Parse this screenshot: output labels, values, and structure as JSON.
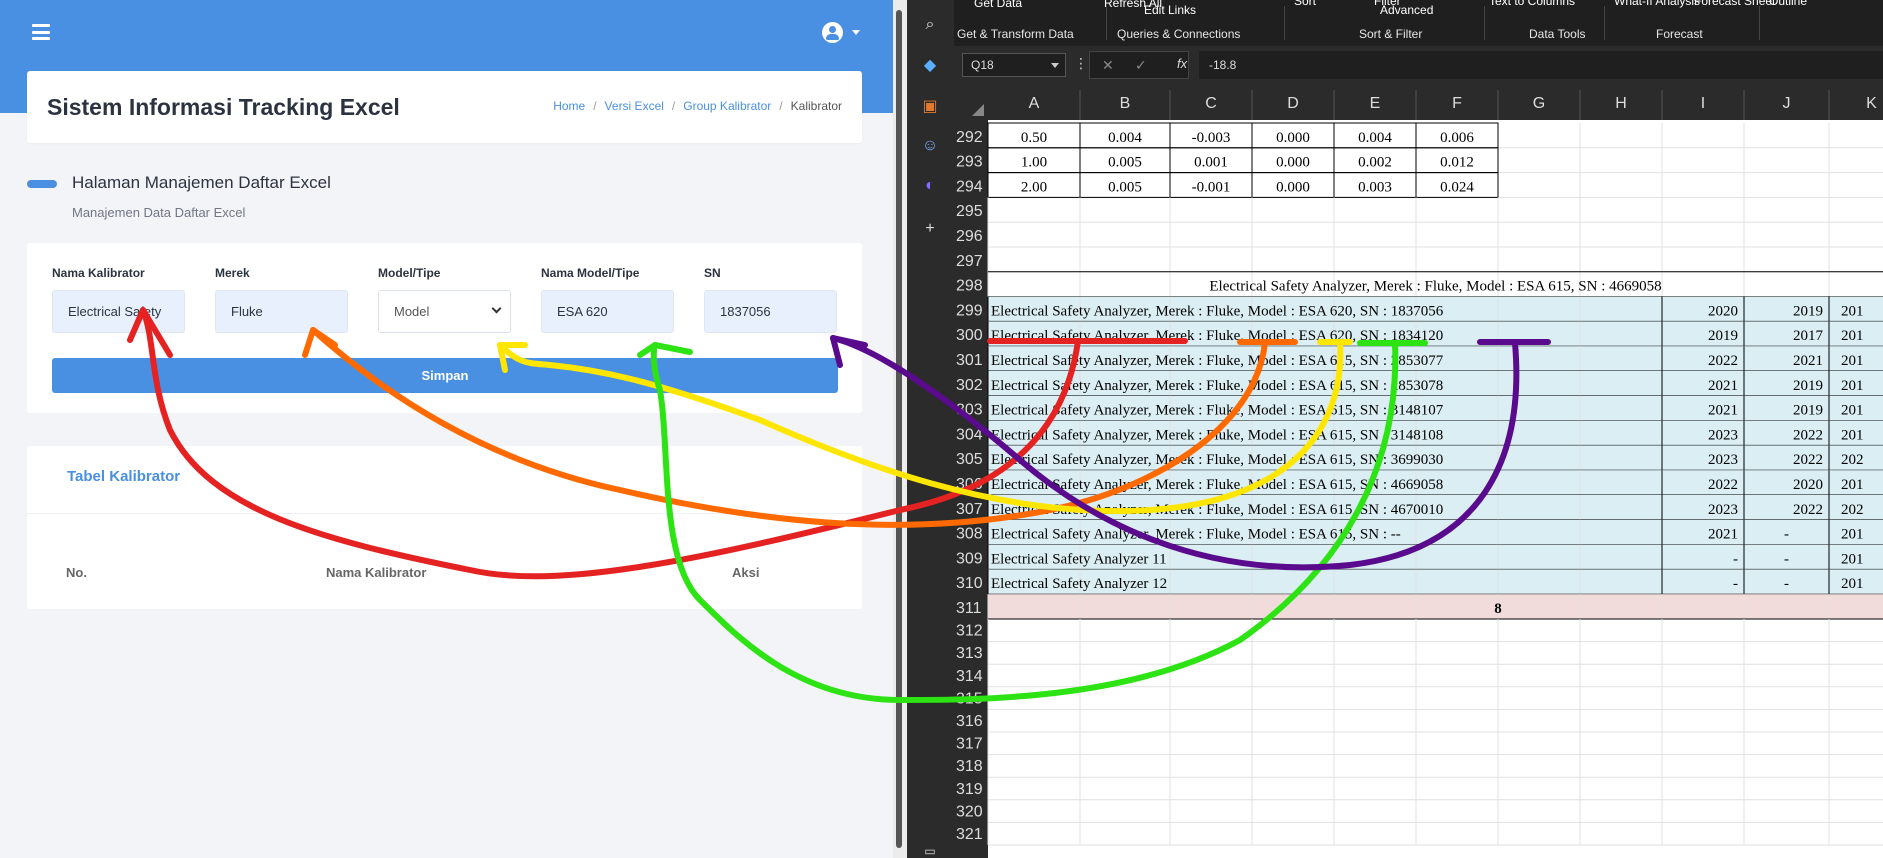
{
  "web": {
    "app_title": "Sistem Informasi Tracking Excel",
    "breadcrumbs": [
      "Home",
      "Versi Excel",
      "Group Kalibrator",
      "Kalibrator"
    ],
    "section_title": "Halaman Manajemen Daftar Excel",
    "section_subtitle": "Manajemen Data Daftar Excel",
    "form": {
      "labels": [
        "Nama Kalibrator",
        "Merek",
        "Model/Tipe",
        "Nama Model/Tipe",
        "SN"
      ],
      "nama_kalibrator": "Electrical Safety",
      "merek": "Fluke",
      "model_select": "Model",
      "nama_model": "ESA 620",
      "sn": "1837056",
      "save_label": "Simpan"
    },
    "table": {
      "title": "Tabel Kalibrator",
      "headers": [
        "No.",
        "Nama Kalibrator",
        "Aksi"
      ]
    },
    "colors": {
      "primary": "#4a90e2"
    }
  },
  "excel": {
    "ribbon": {
      "items": [
        "Get Data",
        "Refresh All",
        "Edit Links",
        "Sort",
        "Filter",
        "Advanced",
        "Text to Columns",
        "What-If Analysis",
        "Forecast Sheet",
        "Outline"
      ],
      "groups": [
        "Get & Transform Data",
        "Queries & Connections",
        "Sort & Filter",
        "Data Tools",
        "Forecast"
      ]
    },
    "name_box": "Q18",
    "fx": "fx",
    "formula": "-18.8",
    "columns": [
      "A",
      "B",
      "C",
      "D",
      "E",
      "F",
      "G",
      "H",
      "I",
      "J",
      "K"
    ],
    "top_rows": [
      {
        "row": "292",
        "cells": [
          "0.50",
          "0.004",
          "-0.003",
          "0.000",
          "0.004",
          "0.006"
        ]
      },
      {
        "row": "293",
        "cells": [
          "1.00",
          "0.005",
          "0.001",
          "0.000",
          "0.002",
          "0.012"
        ]
      },
      {
        "row": "294",
        "cells": [
          "2.00",
          "0.005",
          "-0.001",
          "0.000",
          "0.003",
          "0.024"
        ]
      }
    ],
    "empty_rows": [
      "295",
      "296",
      "297"
    ],
    "header_row": {
      "row": "298",
      "text": "Electrical Safety Analyzer, Merek : Fluke, Model : ESA 615, SN : 4669058"
    },
    "list_rows": [
      {
        "row": "299",
        "text": "Electrical Safety Analyzer, Merek : Fluke, Model : ESA 620, SN : 1837056",
        "i": "2020",
        "j": "2019",
        "k": "201"
      },
      {
        "row": "300",
        "text": "Electrical Safety Analyzer, Merek : Fluke, Model : ESA 620, SN : 1834120",
        "i": "2019",
        "j": "2017",
        "k": "201"
      },
      {
        "row": "301",
        "text": "Electrical Safety Analyzer, Merek : Fluke, Model : ESA 615, SN : 2853077",
        "i": "2022",
        "j": "2021",
        "k": "201"
      },
      {
        "row": "302",
        "text": "Electrical Safety Analyzer, Merek : Fluke, Model : ESA 615, SN : 2853078",
        "i": "2021",
        "j": "2019",
        "k": "201"
      },
      {
        "row": "303",
        "text": "Electrical Safety Analyzer, Merek : Fluke, Model : ESA 615, SN : 3148107",
        "i": "2021",
        "j": "2019",
        "k": "201"
      },
      {
        "row": "304",
        "text": "Electrical Safety Analyzer, Merek : Fluke, Model : ESA 615, SN : 3148108",
        "i": "2023",
        "j": "2022",
        "k": "201"
      },
      {
        "row": "305",
        "text": "Electrical Safety Analyzer, Merek : Fluke, Model : ESA 615, SN : 3699030",
        "i": "2023",
        "j": "2022",
        "k": "202"
      },
      {
        "row": "306",
        "text": "Electrical Safety Analyzer, Merek : Fluke, Model : ESA 615, SN : 4669058",
        "i": "2022",
        "j": "2020",
        "k": "201"
      },
      {
        "row": "307",
        "text": "Electrical Safety Analyzer, Merek : Fluke, Model : ESA 615, SN : 4670010",
        "i": "2023",
        "j": "2022",
        "k": "202"
      },
      {
        "row": "308",
        "text": "Electrical Safety Analyzer, Merek : Fluke, Model : ESA 615, SN : --",
        "i": "2021",
        "j": "-",
        "k": "201"
      },
      {
        "row": "309",
        "text": "Electrical Safety Analyzer 11",
        "i": "-",
        "j": "-",
        "k": "201"
      },
      {
        "row": "310",
        "text": "Electrical Safety Analyzer 12",
        "i": "-",
        "j": "-",
        "k": "201"
      }
    ],
    "total_row": {
      "row": "311",
      "value": "8"
    },
    "tail_rows": [
      "312",
      "313",
      "314",
      "315",
      "316",
      "317",
      "318",
      "319",
      "320",
      "321"
    ]
  },
  "annotations": {
    "colors": [
      "#e52222",
      "#ff6a00",
      "#ffe600",
      "#2ee314",
      "#5a0a8c"
    ]
  }
}
